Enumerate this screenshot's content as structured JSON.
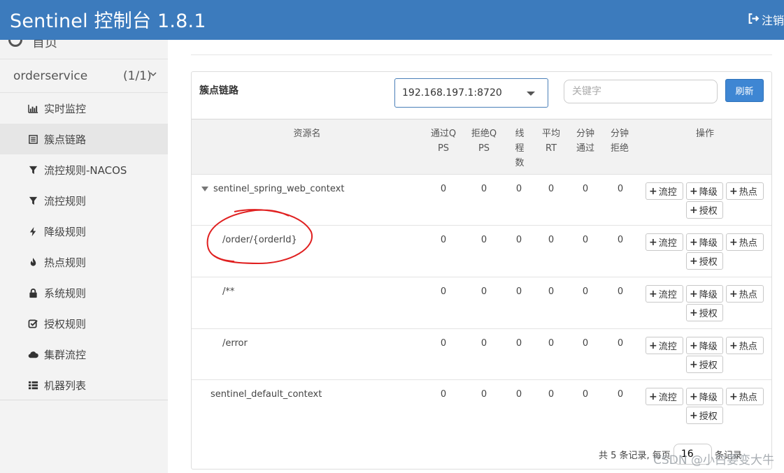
{
  "header": {
    "title": "Sentinel 控制台 1.8.1",
    "logout_label": "注销"
  },
  "sidebar": {
    "home_label": "首页",
    "app": {
      "name": "orderservice",
      "count": "(1/1)"
    },
    "items": [
      {
        "label": "实时监控",
        "icon": "bar-chart-icon"
      },
      {
        "label": "簇点链路",
        "icon": "list-icon",
        "active": true
      },
      {
        "label": "流控规则-NACOS",
        "icon": "filter-icon"
      },
      {
        "label": "流控规则",
        "icon": "filter-icon"
      },
      {
        "label": "降级规则",
        "icon": "bolt-icon"
      },
      {
        "label": "热点规则",
        "icon": "fire-icon"
      },
      {
        "label": "系统规则",
        "icon": "lock-icon"
      },
      {
        "label": "授权规则",
        "icon": "check-icon"
      },
      {
        "label": "集群流控",
        "icon": "cloud-icon"
      },
      {
        "label": "机器列表",
        "icon": "th-list-icon"
      }
    ]
  },
  "panel": {
    "title": "簇点链路",
    "machine": "192.168.197.1:8720",
    "keyword_placeholder": "关键字",
    "refresh_label": "刷新"
  },
  "table": {
    "headers": {
      "resource": "资源名",
      "pass_qps": [
        "通过Q",
        "PS"
      ],
      "block_qps": [
        "拒绝Q",
        "PS"
      ],
      "threads": [
        "线",
        "程",
        "数"
      ],
      "avg_rt": [
        "平均",
        "RT"
      ],
      "minute_pass": [
        "分钟",
        "通过"
      ],
      "minute_block": [
        "分钟",
        "拒绝"
      ],
      "ops": "操作"
    },
    "rows": [
      {
        "name": "sentinel_spring_web_context",
        "pass_qps": "0",
        "block_qps": "0",
        "threads": "0",
        "avg_rt": "0",
        "minute_pass": "0",
        "minute_block": "0"
      },
      {
        "name": "/order/{orderId}",
        "pass_qps": "0",
        "block_qps": "0",
        "threads": "0",
        "avg_rt": "0",
        "minute_pass": "0",
        "minute_block": "0"
      },
      {
        "name": "/**",
        "pass_qps": "0",
        "block_qps": "0",
        "threads": "0",
        "avg_rt": "0",
        "minute_pass": "0",
        "minute_block": "0"
      },
      {
        "name": "/error",
        "pass_qps": "0",
        "block_qps": "0",
        "threads": "0",
        "avg_rt": "0",
        "minute_pass": "0",
        "minute_block": "0"
      },
      {
        "name": "sentinel_default_context",
        "pass_qps": "0",
        "block_qps": "0",
        "threads": "0",
        "avg_rt": "0",
        "minute_pass": "0",
        "minute_block": "0"
      }
    ],
    "ops": {
      "flow": "流控",
      "degrade": "降级",
      "hot": "热点",
      "auth": "授权"
    }
  },
  "pager": {
    "total_text": "共 5 条记录, 每页",
    "page_size": "16",
    "suffix": "条记录"
  },
  "watermark": "CSDN @小白要变大牛",
  "colors": {
    "header_bg": "#3c7bbd",
    "annotation": "#e02020",
    "primary_button": "#3e86d3"
  }
}
